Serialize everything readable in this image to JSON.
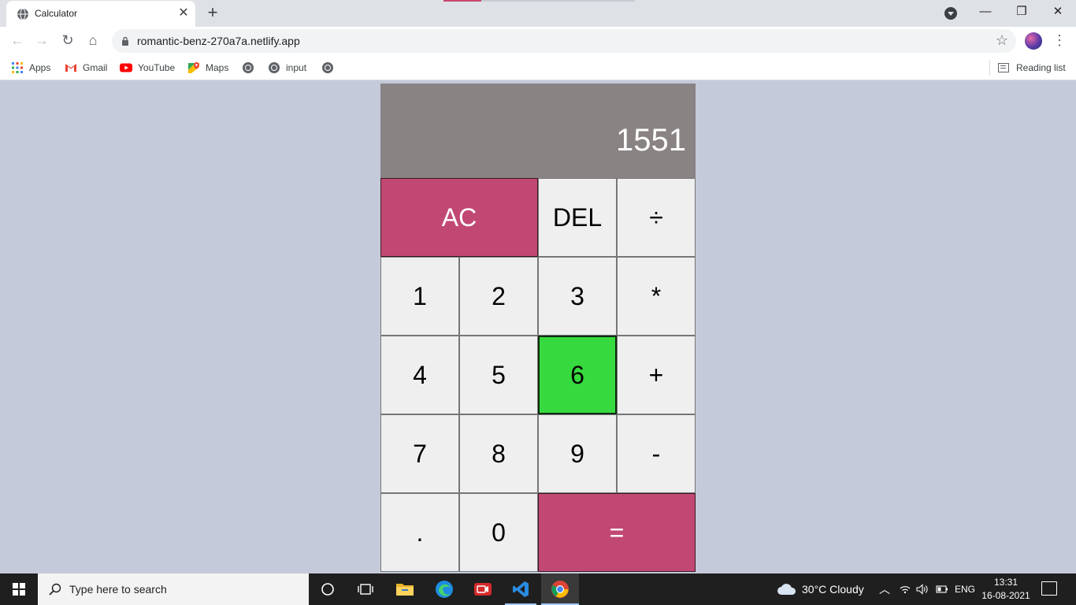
{
  "browser": {
    "tab": {
      "title": "Calculator",
      "close_glyph": "✕"
    },
    "new_tab_glyph": "+",
    "window_controls": {
      "minimize": "—",
      "maximize": "❐",
      "close": "✕"
    },
    "toolbar": {
      "back_glyph": "←",
      "forward_glyph": "→",
      "reload_glyph": "↻",
      "home_glyph": "⌂",
      "url": "romantic-benz-270a7a.netlify.app",
      "star_glyph": "☆",
      "menu_glyph": "⋮"
    },
    "bookmarks": {
      "items": [
        {
          "label": "Apps",
          "icon": "apps-grid-icon"
        },
        {
          "label": "Gmail",
          "icon": "gmail-icon"
        },
        {
          "label": "YouTube",
          "icon": "youtube-icon"
        },
        {
          "label": "Maps",
          "icon": "maps-icon"
        },
        {
          "label": "",
          "icon": "globe-icon"
        },
        {
          "label": "input",
          "icon": "globe-icon"
        },
        {
          "label": "",
          "icon": "globe-icon"
        }
      ],
      "reading_list": "Reading list"
    }
  },
  "calculator": {
    "display": "1551",
    "keys": [
      {
        "label": "AC",
        "style": "pink",
        "span": 2
      },
      {
        "label": "DEL"
      },
      {
        "label": "÷"
      },
      {
        "label": "1"
      },
      {
        "label": "2"
      },
      {
        "label": "3"
      },
      {
        "label": "*"
      },
      {
        "label": "4"
      },
      {
        "label": "5"
      },
      {
        "label": "6",
        "style": "green"
      },
      {
        "label": "+"
      },
      {
        "label": "7"
      },
      {
        "label": "8"
      },
      {
        "label": "9"
      },
      {
        "label": "-"
      },
      {
        "label": "."
      },
      {
        "label": "0"
      },
      {
        "label": "=",
        "style": "pink",
        "span": 2
      }
    ],
    "colors": {
      "display_bg": "#898383",
      "pink": "#c24874",
      "green": "#37da3e",
      "page_bg": "#c5cadb"
    }
  },
  "taskbar": {
    "search_placeholder": "Type here to search",
    "weather": "30°C  Cloudy",
    "language": "ENG",
    "time": "13:31",
    "date": "16-08-2021"
  }
}
